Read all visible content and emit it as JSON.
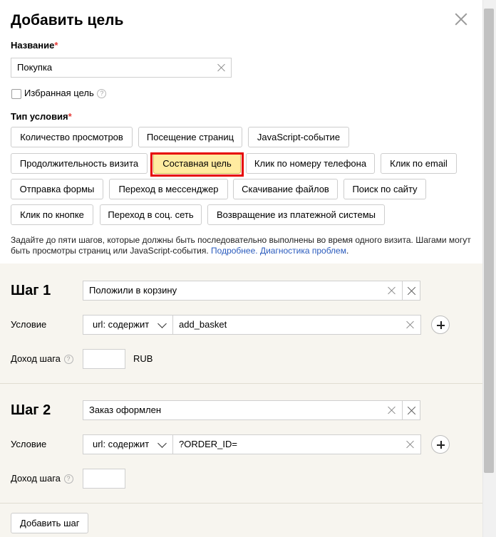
{
  "dialog": {
    "title": "Добавить цель"
  },
  "name_field": {
    "label": "Название",
    "required_mark": "*",
    "value": "Покупка"
  },
  "favorite": {
    "label": "Избранная цель",
    "help": "?"
  },
  "condition_type": {
    "label": "Тип условия",
    "required_mark": "*",
    "options": [
      "Количество просмотров",
      "Посещение страниц",
      "JavaScript-событие",
      "Продолжительность визита",
      "Составная цель",
      "Клик по номеру телефона",
      "Клик по email",
      "Отправка формы",
      "Переход в мессенджер",
      "Скачивание файлов",
      "Поиск по сайту",
      "Клик по кнопке",
      "Переход в соц. сеть",
      "Возвращение из платежной системы"
    ],
    "selected": "Составная цель"
  },
  "description": {
    "text": "Задайте до пяти шагов, которые должны быть последовательно выполнены во время одного визита. Шагами могут быть просмотры страниц или JavaScript-события. ",
    "link_more": "Подробнее.",
    "link_diag": "Диагностика проблем",
    "end": "."
  },
  "steps": [
    {
      "title": "Шаг 1",
      "name_value": "Положили в корзину",
      "condition_label": "Условие",
      "condition_type": "url: содержит",
      "condition_value": "add_basket",
      "income_label": "Доход шага",
      "income_help": "?",
      "currency": "RUB"
    },
    {
      "title": "Шаг 2",
      "name_value": "Заказ оформлен",
      "condition_label": "Условие",
      "condition_type": "url: содержит",
      "condition_value": "?ORDER_ID=",
      "income_label": "Доход шага",
      "income_help": "?",
      "currency": ""
    }
  ],
  "add_step_button": "Добавить шаг",
  "colors": {
    "selected_chip": "#ffeba0",
    "highlight_border": "#e60000",
    "link": "#2a5bbd",
    "steps_background": "#f7f5ef"
  }
}
